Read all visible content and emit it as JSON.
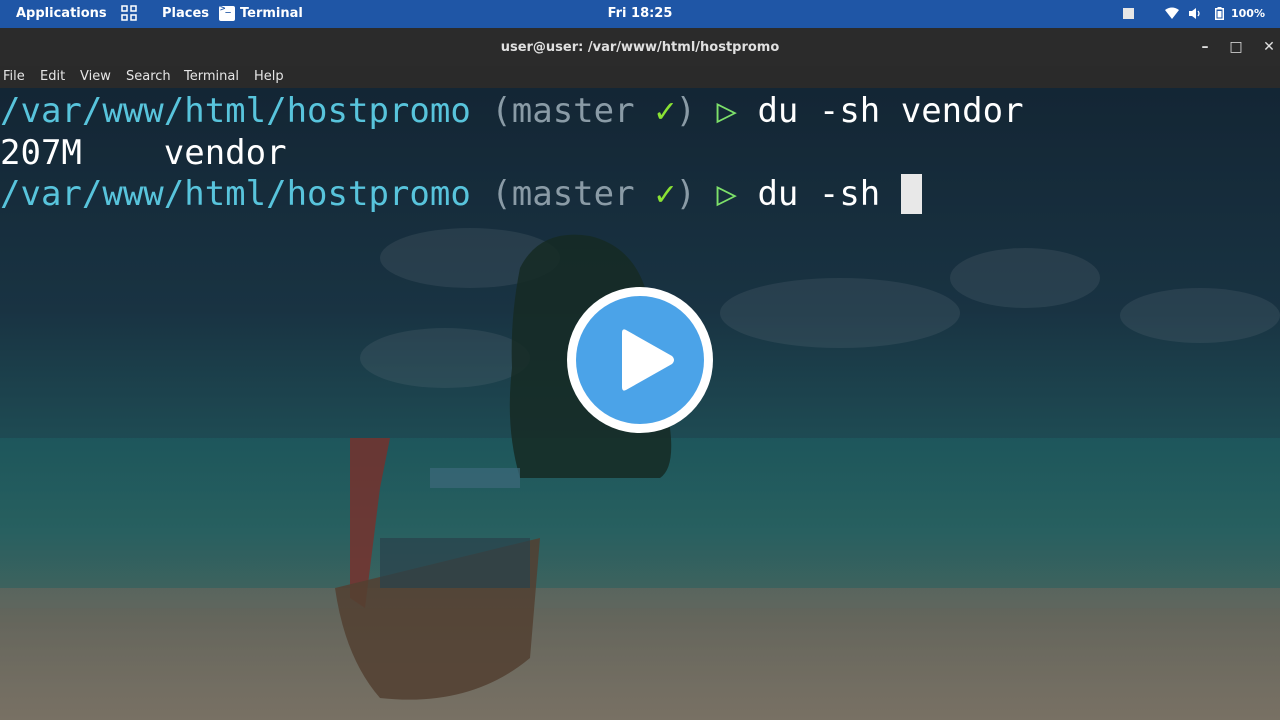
{
  "top_panel": {
    "applications": "Applications",
    "places": "Places",
    "terminal_app": "Terminal",
    "clock": "Fri 18:25",
    "battery": "100%",
    "icons": [
      "grid-icon",
      "terminal-icon",
      "box-icon",
      "wifi-icon",
      "volume-icon",
      "battery-icon"
    ]
  },
  "window": {
    "title": "user@user: /var/www/html/hostpromo",
    "controls": [
      "minimize",
      "maximize",
      "close"
    ]
  },
  "menu": {
    "items": [
      "File",
      "Edit",
      "View",
      "Search",
      "Terminal",
      "Help"
    ]
  },
  "terminal": {
    "lines": [
      {
        "path": "/var/www/html/hostpromo",
        "branch_open": " (master ",
        "check": "✓",
        "branch_close": ")",
        "arrow": " ▷ ",
        "command": "du -sh vendor"
      },
      {
        "output": "207M    vendor"
      },
      {
        "path": "/var/www/html/hostpromo",
        "branch_open": " (master ",
        "check": "✓",
        "branch_close": ")",
        "arrow": " ▷ ",
        "command": "du -sh "
      }
    ]
  },
  "colors": {
    "panel": "#1f56a6",
    "path": "#58c4dc",
    "check": "#8ae234",
    "play": "#4ba3e8"
  }
}
